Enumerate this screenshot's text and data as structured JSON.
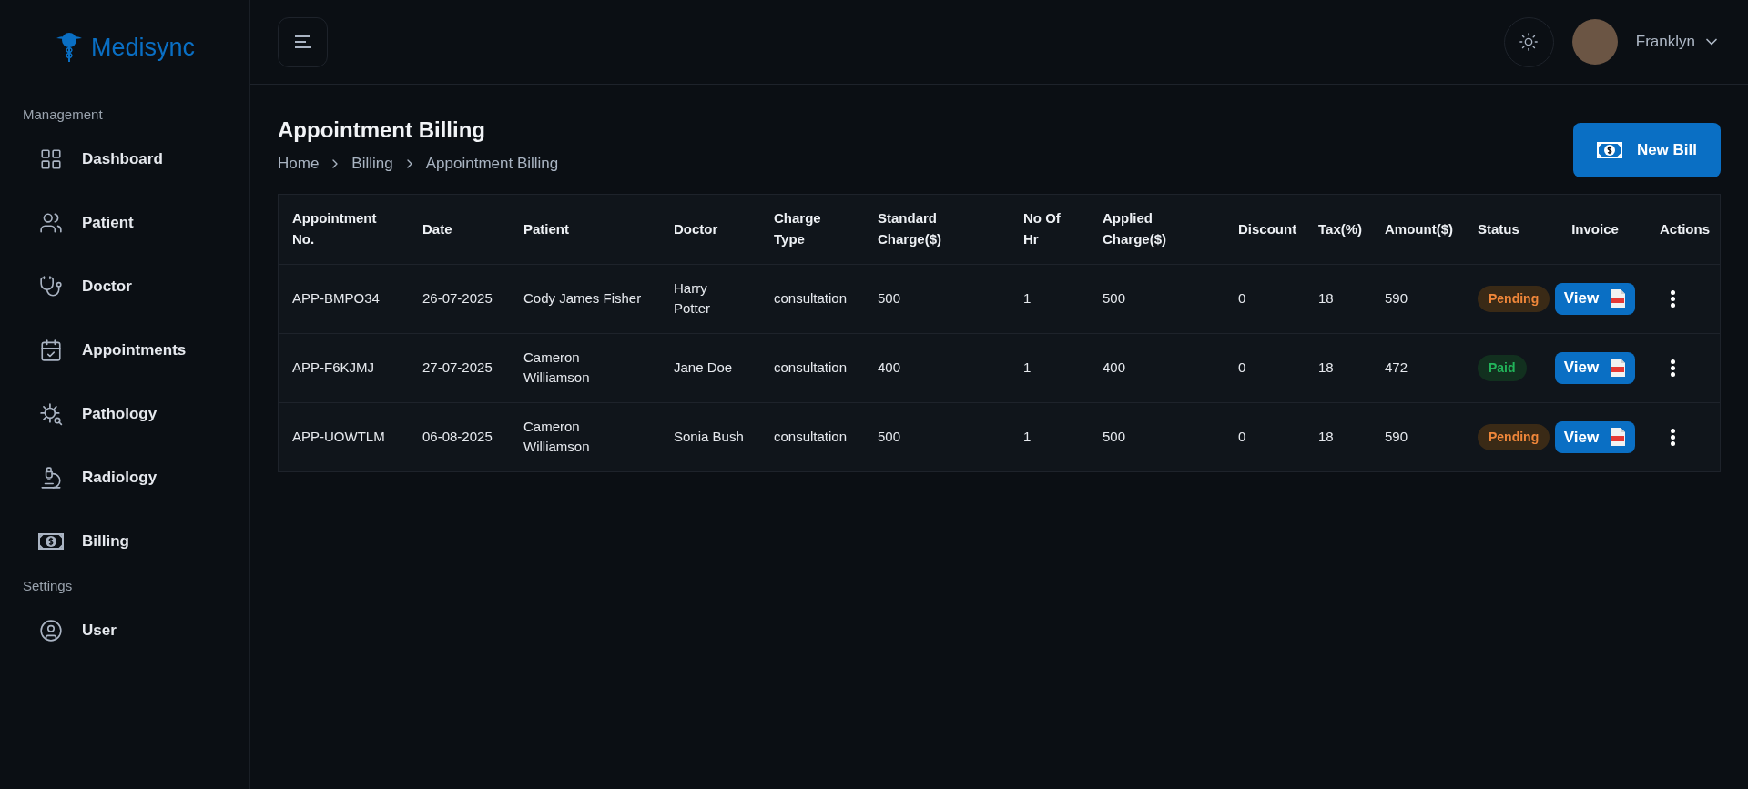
{
  "brand": {
    "name": "Medisync"
  },
  "sidebar": {
    "sections": [
      {
        "title": "Management",
        "items": [
          {
            "label": "Dashboard",
            "kind": "grid"
          },
          {
            "label": "Patient",
            "kind": "users"
          },
          {
            "label": "Doctor",
            "kind": "stethoscope"
          },
          {
            "label": "Appointments",
            "kind": "calendar"
          },
          {
            "label": "Pathology",
            "kind": "virus"
          },
          {
            "label": "Radiology",
            "kind": "microscope"
          },
          {
            "label": "Billing",
            "kind": "money"
          }
        ]
      },
      {
        "title": "Settings",
        "items": [
          {
            "label": "User",
            "kind": "user"
          }
        ]
      }
    ]
  },
  "header": {
    "user": {
      "name": "Franklyn"
    }
  },
  "page": {
    "title": "Appointment Billing",
    "breadcrumb": [
      "Home",
      "Billing",
      "Appointment Billing"
    ],
    "new_button": "New Bill"
  },
  "table": {
    "columns": [
      "Appointment No.",
      "Date",
      "Patient",
      "Doctor",
      "Charge Type",
      "Standard Charge($)",
      "No Of Hr",
      "Applied Charge($)",
      "Discount",
      "Tax(%)",
      "Amount($)",
      "Status",
      "Invoice",
      "Actions"
    ],
    "rows": [
      {
        "cells": [
          "APP-BMPO34",
          "26-07-2025",
          "Cody James Fisher",
          "Harry Potter",
          "consultation",
          "500",
          "1",
          "500",
          "0",
          "18",
          "590"
        ],
        "status": {
          "label": "Pending",
          "kind": "pending"
        },
        "invoice": "View"
      },
      {
        "cells": [
          "APP-F6KJMJ",
          "27-07-2025",
          "Cameron Williamson",
          "Jane Doe",
          "consultation",
          "400",
          "1",
          "400",
          "0",
          "18",
          "472"
        ],
        "status": {
          "label": "Paid",
          "kind": "paid"
        },
        "invoice": "View"
      },
      {
        "cells": [
          "APP-UOWTLM",
          "06-08-2025",
          "Cameron Williamson",
          "Sonia Bush",
          "consultation",
          "500",
          "1",
          "500",
          "0",
          "18",
          "590"
        ],
        "status": {
          "label": "Pending",
          "kind": "pending"
        },
        "invoice": "View"
      }
    ]
  }
}
